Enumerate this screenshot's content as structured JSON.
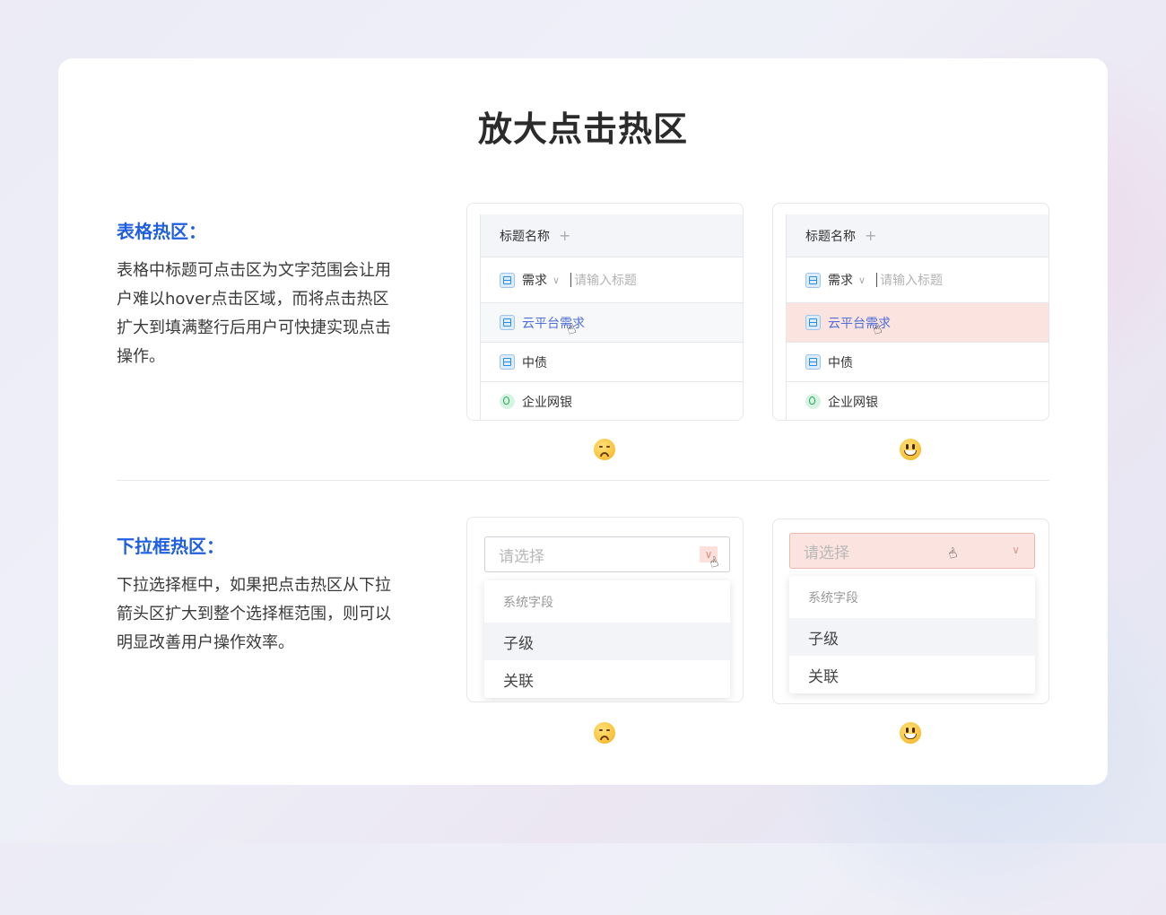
{
  "title": "放大点击热区",
  "sections": [
    {
      "heading": "表格热区：",
      "description": "表格中标题可点击区为文字范围会让用户难以hover点击区域，而将点击热区扩大到填满整行后用户可快捷实现点击操作。"
    },
    {
      "heading": "下拉框热区：",
      "description": "下拉选择框中，如果把点击热区从下拉箭头区扩大到整个选择框范围，则可以明显改善用户操作效率。"
    }
  ],
  "table": {
    "header": "标题名称",
    "header_add": "+",
    "type_label": "需求",
    "input_placeholder": "请输入标题",
    "rows": [
      "云平台需求",
      "中债",
      "企业网银"
    ]
  },
  "dropdown": {
    "placeholder": "请选择",
    "group_label": "系统字段",
    "options": [
      "子级",
      "关联"
    ]
  },
  "colors": {
    "accent": "#1f5fe0",
    "hotzone": "#fbe3df",
    "link": "#4f6ed8"
  },
  "icons": {
    "bad": "disappointed-face-icon",
    "good": "smiling-face-icon",
    "cursor": "hand-pointer-icon",
    "row_type": "requirement-icon",
    "row_type_alt": "lightbulb-icon"
  }
}
